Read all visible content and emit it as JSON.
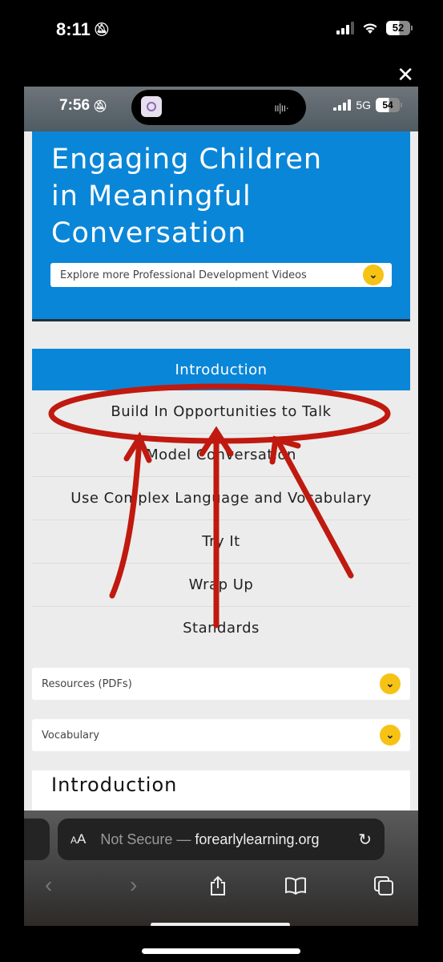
{
  "outer_status": {
    "time": "8:11",
    "battery": "52",
    "silent": true
  },
  "inner_status": {
    "time": "7:56",
    "network": "5G",
    "battery": "54"
  },
  "hero": {
    "title_lines": [
      "Engaging Children",
      "in Meaningful",
      "Conversation"
    ],
    "explore_dropdown": "Explore more Professional Development Videos"
  },
  "menu": {
    "items": [
      {
        "label": "Introduction",
        "active": true
      },
      {
        "label": "Build In Opportunities to Talk"
      },
      {
        "label": "Model Conversation"
      },
      {
        "label": "Use Complex Language and Vocabulary"
      },
      {
        "label": "Try It"
      },
      {
        "label": "Wrap Up"
      },
      {
        "label": "Standards"
      }
    ]
  },
  "accordions": [
    {
      "label": "Resources (PDFs)"
    },
    {
      "label": "Vocabulary"
    }
  ],
  "section": {
    "title": "Introduction"
  },
  "safari": {
    "text_size_label": "AA",
    "url_prefix": "Not Secure — ",
    "url_domain": "forearlylearning.org"
  },
  "annotation": {
    "color": "#c0190f",
    "description": "Red circle around 'Build In Opportunities to Talk' with three arrows pointing to it"
  },
  "colors": {
    "brand_blue": "#0a86d8",
    "accent_yellow": "#f6c315"
  }
}
